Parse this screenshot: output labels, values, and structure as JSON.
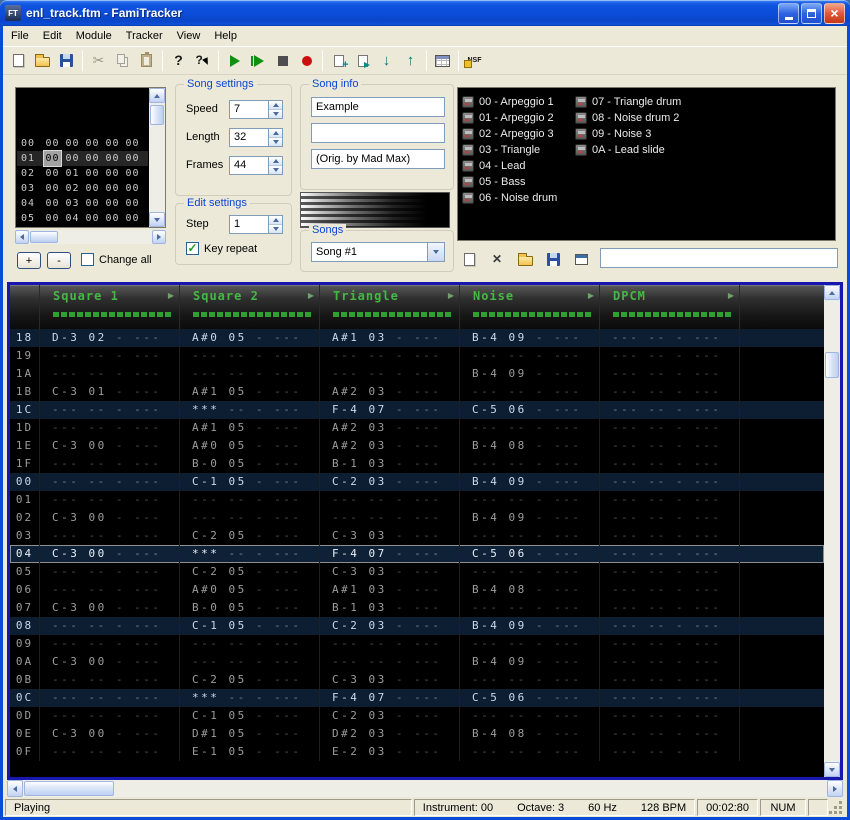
{
  "window": {
    "title": "enl_track.ftm - FamiTracker",
    "icon_label": "FT"
  },
  "menu": [
    "File",
    "Edit",
    "Module",
    "Tracker",
    "View",
    "Help"
  ],
  "toolbar": {
    "nsf_label": "NSF"
  },
  "frame_editor": {
    "rows": [
      {
        "frame": "00",
        "patterns": [
          "00",
          "00",
          "00",
          "00",
          "00"
        ],
        "selected": false
      },
      {
        "frame": "01",
        "patterns": [
          "00",
          "00",
          "00",
          "00",
          "00"
        ],
        "selected": true
      },
      {
        "frame": "02",
        "patterns": [
          "00",
          "01",
          "00",
          "00",
          "00"
        ],
        "selected": false
      },
      {
        "frame": "03",
        "patterns": [
          "00",
          "02",
          "00",
          "00",
          "00"
        ],
        "selected": false
      },
      {
        "frame": "04",
        "patterns": [
          "00",
          "03",
          "00",
          "00",
          "00"
        ],
        "selected": false
      },
      {
        "frame": "05",
        "patterns": [
          "00",
          "04",
          "00",
          "00",
          "00"
        ],
        "selected": false
      }
    ],
    "add_label": "+",
    "remove_label": "-",
    "change_all_label": "Change all"
  },
  "song_settings": {
    "title": "Song settings",
    "speed_label": "Speed",
    "speed": "7",
    "length_label": "Length",
    "length": "32",
    "frames_label": "Frames",
    "frames": "44"
  },
  "edit_settings": {
    "title": "Edit settings",
    "step_label": "Step",
    "step": "1",
    "key_repeat_label": "Key repeat",
    "key_repeat_checked": true
  },
  "song_info": {
    "title": "Song info",
    "name": "Example",
    "author": "",
    "copyright": "(Orig. by Mad Max)"
  },
  "songs": {
    "title": "Songs",
    "selected": "Song #1"
  },
  "instruments": {
    "items": [
      "00 - Arpeggio 1",
      "01 - Arpeggio 2",
      "02 - Arpeggio 3",
      "03 - Triangle",
      "04 - Lead",
      "05 - Bass",
      "06 - Noise drum",
      "07 - Triangle drum",
      "08 - Noise drum 2",
      "09 - Noise 3",
      "0A - Lead slide"
    ],
    "name_value": ""
  },
  "pattern_editor": {
    "channels": [
      "Square 1",
      "Square 2",
      "Triangle",
      "Noise",
      "DPCM"
    ],
    "cursor_row": "04",
    "rows": [
      {
        "row": "18",
        "cells": [
          "D-3 02",
          "A#0 05",
          "A#1 03",
          "B-4 09",
          ""
        ]
      },
      {
        "row": "19",
        "cells": [
          "",
          "",
          "",
          "",
          ""
        ]
      },
      {
        "row": "1A",
        "cells": [
          "",
          "",
          "",
          "B-4 09",
          ""
        ]
      },
      {
        "row": "1B",
        "cells": [
          "C-3 01",
          "A#1 05",
          "A#2 03",
          "",
          ""
        ]
      },
      {
        "row": "1C",
        "cells": [
          "",
          "***",
          "F-4 07",
          "C-5 06",
          ""
        ]
      },
      {
        "row": "1D",
        "cells": [
          "",
          "A#1 05",
          "A#2 03",
          "",
          ""
        ]
      },
      {
        "row": "1E",
        "cells": [
          "C-3 00",
          "A#0 05",
          "A#2 03",
          "B-4 08",
          ""
        ]
      },
      {
        "row": "1F",
        "cells": [
          "",
          "B-0 05",
          "B-1 03",
          "",
          ""
        ]
      },
      {
        "row": "00",
        "cells": [
          "",
          "C-1 05",
          "C-2 03",
          "B-4 09",
          ""
        ]
      },
      {
        "row": "01",
        "cells": [
          "",
          "",
          "",
          "",
          ""
        ]
      },
      {
        "row": "02",
        "cells": [
          "C-3 00",
          "",
          "",
          "B-4 09",
          ""
        ]
      },
      {
        "row": "03",
        "cells": [
          "",
          "C-2 05",
          "C-3 03",
          "",
          ""
        ]
      },
      {
        "row": "04",
        "cells": [
          "C-3 00",
          "***",
          "F-4 07",
          "C-5 06",
          ""
        ]
      },
      {
        "row": "05",
        "cells": [
          "",
          "C-2 05",
          "C-3 03",
          "",
          ""
        ]
      },
      {
        "row": "06",
        "cells": [
          "",
          "A#0 05",
          "A#1 03",
          "B-4 08",
          ""
        ]
      },
      {
        "row": "07",
        "cells": [
          "C-3 00",
          "B-0 05",
          "B-1 03",
          "",
          ""
        ]
      },
      {
        "row": "08",
        "cells": [
          "",
          "C-1 05",
          "C-2 03",
          "B-4 09",
          ""
        ]
      },
      {
        "row": "09",
        "cells": [
          "",
          "",
          "",
          "",
          ""
        ]
      },
      {
        "row": "0A",
        "cells": [
          "C-3 00",
          "",
          "",
          "B-4 09",
          ""
        ]
      },
      {
        "row": "0B",
        "cells": [
          "",
          "C-2 05",
          "C-3 03",
          "",
          ""
        ]
      },
      {
        "row": "0C",
        "cells": [
          "",
          "***",
          "F-4 07",
          "C-5 06",
          ""
        ]
      },
      {
        "row": "0D",
        "cells": [
          "",
          "C-1 05",
          "C-2 03",
          "",
          ""
        ]
      },
      {
        "row": "0E",
        "cells": [
          "C-3 00",
          "D#1 05",
          "D#2 03",
          "B-4 08",
          ""
        ]
      },
      {
        "row": "0F",
        "cells": [
          "",
          "E-1 05",
          "E-2 03",
          "",
          ""
        ]
      }
    ]
  },
  "status": {
    "message": "Playing",
    "instrument": "Instrument: 00",
    "octave": "Octave: 3",
    "rate": "60 Hz",
    "tempo": "128 BPM",
    "time": "00:02:80",
    "num_lock": "NUM"
  }
}
